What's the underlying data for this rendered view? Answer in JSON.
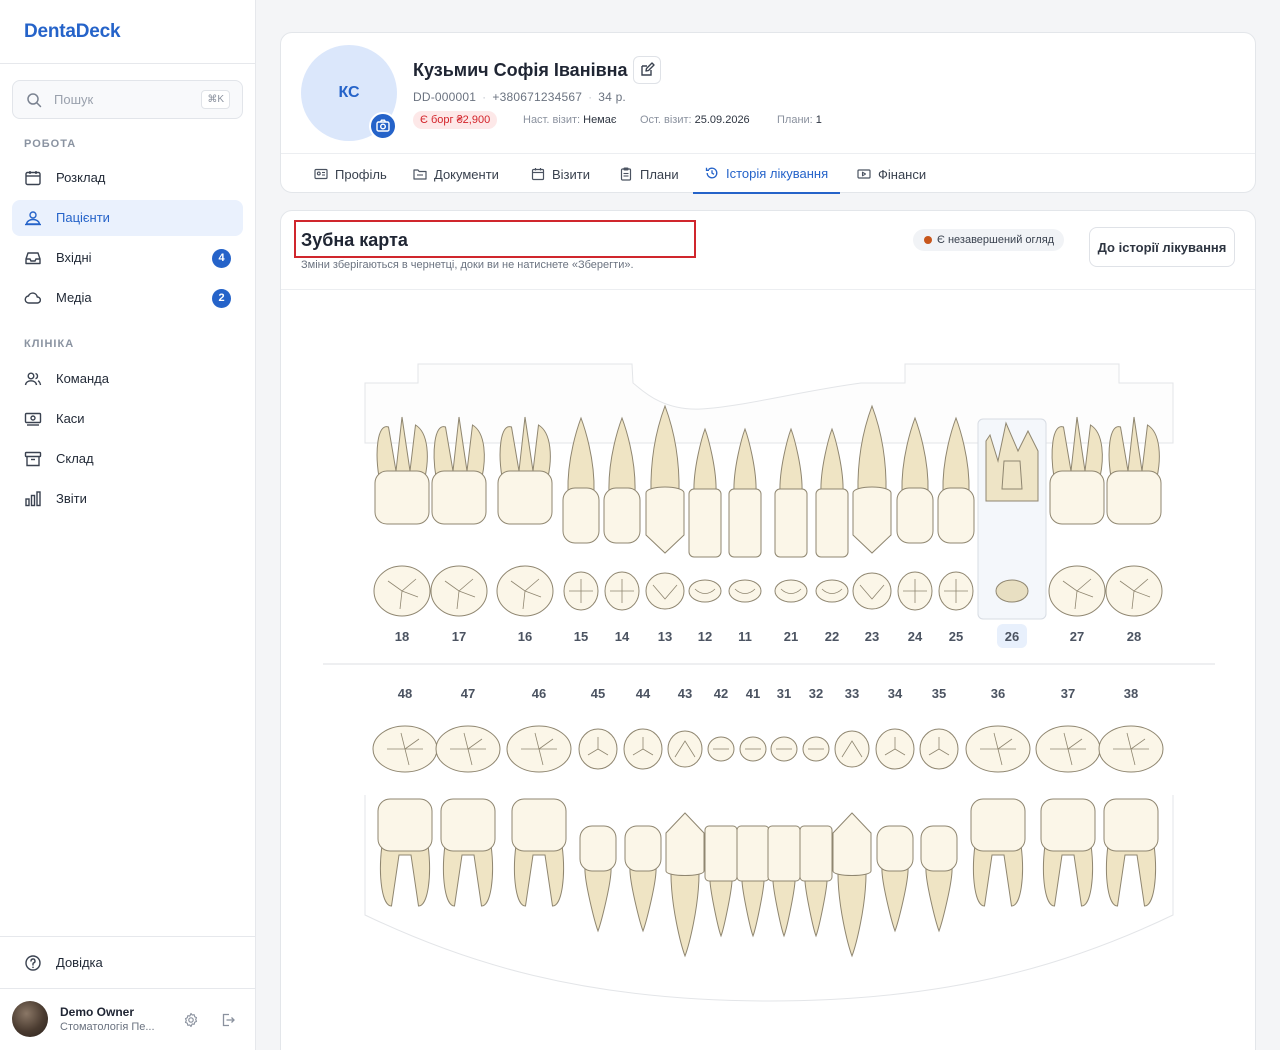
{
  "app": {
    "name": "DentaDeck"
  },
  "sidebar": {
    "search": {
      "placeholder": "Пошук",
      "shortcut": "⌘K"
    },
    "sections": {
      "work": "РОБОТА",
      "clinic": "КЛІНІКА"
    },
    "work_items": [
      {
        "label": "Розклад",
        "icon": "calendar-icon"
      },
      {
        "label": "Пацієнти",
        "icon": "patients-icon",
        "active": true
      },
      {
        "label": "Вхідні",
        "icon": "inbox-icon",
        "badge": "4"
      },
      {
        "label": "Медіа",
        "icon": "cloud-icon",
        "badge": "2"
      }
    ],
    "clinic_items": [
      {
        "label": "Команда",
        "icon": "team-icon"
      },
      {
        "label": "Каси",
        "icon": "cash-icon"
      },
      {
        "label": "Склад",
        "icon": "archive-icon"
      },
      {
        "label": "Звіти",
        "icon": "reports-icon"
      }
    ],
    "help": "Довідка",
    "user": {
      "name": "Demo Owner",
      "org": "Стоматологія Пе..."
    }
  },
  "patient": {
    "initials": "КС",
    "name": "Кузьмич Софія Іванівна",
    "id": "DD-000001",
    "phone": "+380671234567",
    "age": "34 р.",
    "debt": "Є борг ₴2,900",
    "next_visit_label": "Наст. візит:",
    "next_visit_value": "Немає",
    "last_visit_label": "Ост. візит:",
    "last_visit_value": "25.09.2026",
    "plans_label": "Плани:",
    "plans_value": "1"
  },
  "tabs": [
    {
      "label": "Профіль",
      "icon": "id-card-icon"
    },
    {
      "label": "Документи",
      "icon": "folder-icon"
    },
    {
      "label": "Візити",
      "icon": "calendar-icon"
    },
    {
      "label": "Плани",
      "icon": "clipboard-icon"
    },
    {
      "label": "Історія лікування",
      "icon": "history-icon",
      "active": true
    },
    {
      "label": "Фінанси",
      "icon": "finance-icon"
    }
  ],
  "dental_chart": {
    "title": "Зубна карта",
    "subtitle": "Зміни зберігаються в чернетці, доки ви не натиснете «Зберегти».",
    "status_pill": "Є незавершений огляд",
    "history_button": "До історії лікування",
    "selected_tooth": "26",
    "upper_teeth": [
      "18",
      "17",
      "16",
      "15",
      "14",
      "13",
      "12",
      "11",
      "21",
      "22",
      "23",
      "24",
      "25",
      "26",
      "27",
      "28"
    ],
    "lower_teeth": [
      "48",
      "47",
      "46",
      "45",
      "44",
      "43",
      "42",
      "41",
      "31",
      "32",
      "33",
      "34",
      "35",
      "36",
      "37",
      "38"
    ]
  }
}
